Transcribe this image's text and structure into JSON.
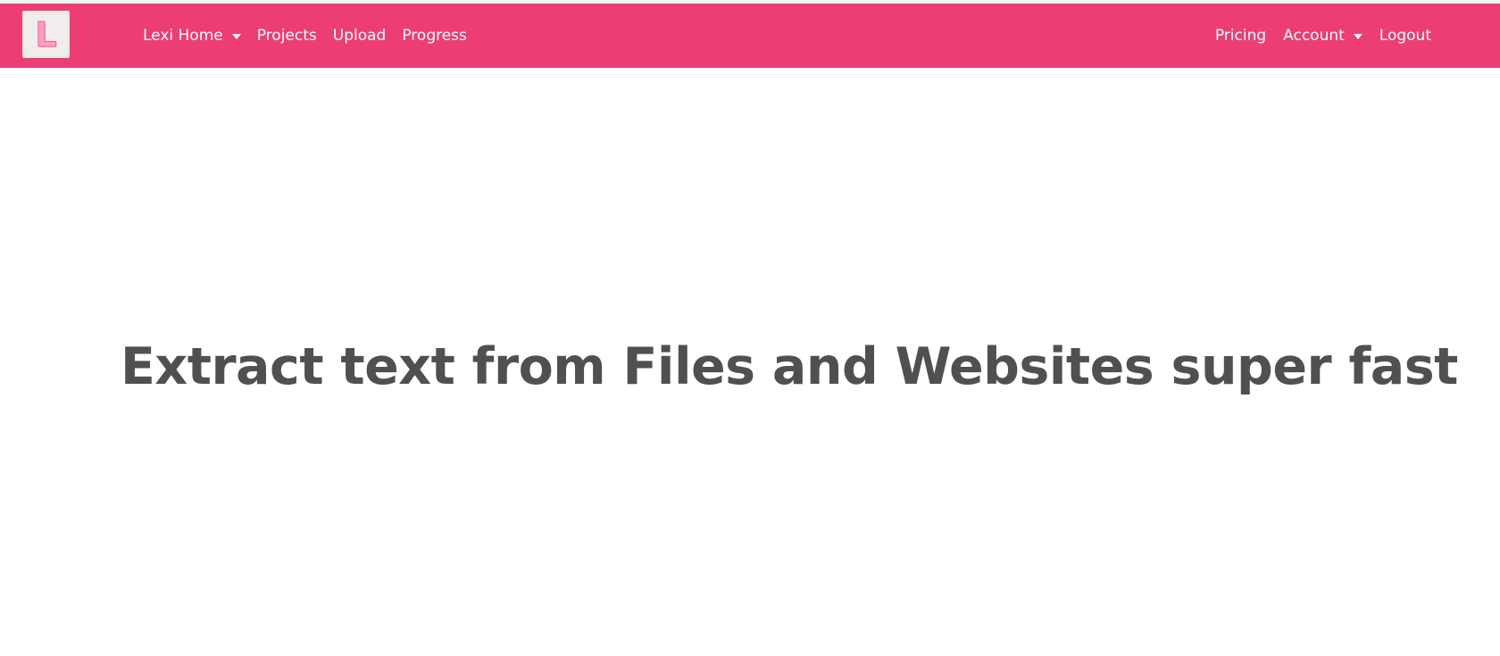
{
  "brand": {
    "logo_letter": "L",
    "color": "#ec3e73"
  },
  "nav": {
    "left": [
      {
        "label": "Lexi Home",
        "dropdown": true
      },
      {
        "label": "Projects",
        "dropdown": false
      },
      {
        "label": "Upload",
        "dropdown": false
      },
      {
        "label": "Progress",
        "dropdown": false
      }
    ],
    "right": [
      {
        "label": "Pricing",
        "dropdown": false
      },
      {
        "label": "Account",
        "dropdown": true
      },
      {
        "label": "Logout",
        "dropdown": false
      }
    ]
  },
  "hero": {
    "title": "Extract text from Files and Websites super fast"
  },
  "icons": {
    "dropdown": "chevron-down-icon"
  }
}
